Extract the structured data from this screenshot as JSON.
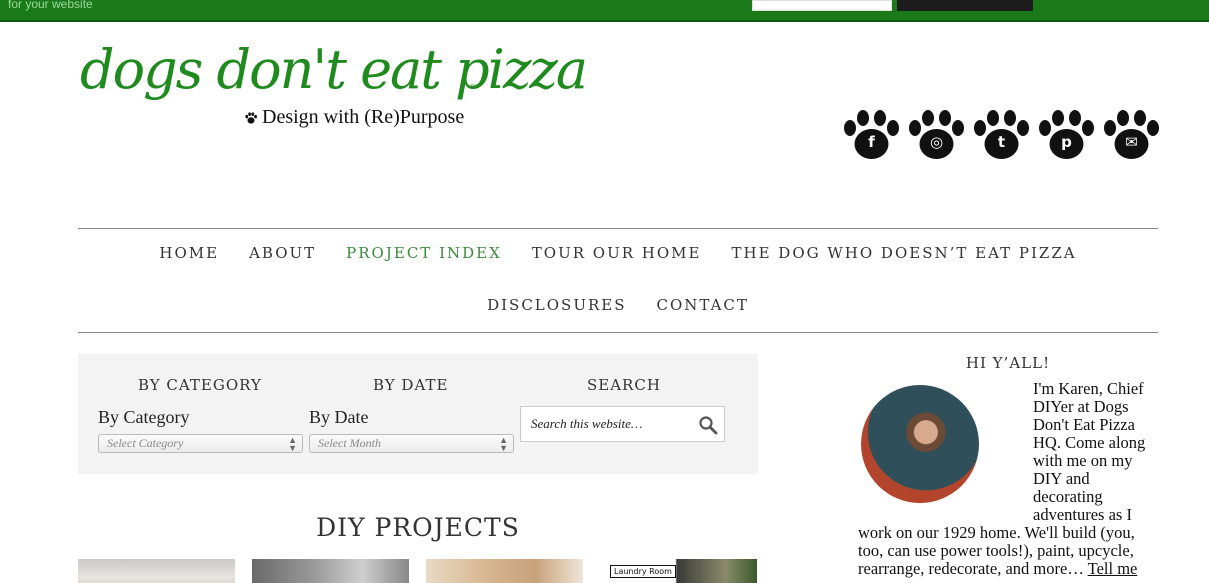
{
  "topbar": {
    "promo_text": "for your website",
    "bar_color": "#1a7a1a"
  },
  "logo": {
    "wordmark": "dogs don't eat pizza",
    "trademark": "™",
    "tagline": "Design with (Re)Purpose",
    "brand_color": "#1f8b1f"
  },
  "social": [
    {
      "name": "facebook",
      "glyph": "f"
    },
    {
      "name": "instagram",
      "glyph": "◎"
    },
    {
      "name": "twitter",
      "glyph": "t"
    },
    {
      "name": "pinterest",
      "glyph": "p"
    },
    {
      "name": "email",
      "glyph": "✉"
    }
  ],
  "nav": {
    "items": [
      {
        "label": "HOME"
      },
      {
        "label": "ABOUT"
      },
      {
        "label": "PROJECT INDEX",
        "active": true
      },
      {
        "label": "TOUR OUR HOME"
      },
      {
        "label": "THE DOG WHO DOESN’T EAT PIZZA"
      },
      {
        "label": "DISCLOSURES"
      },
      {
        "label": "CONTACT"
      }
    ]
  },
  "filters": {
    "category": {
      "heading": "BY CATEGORY",
      "label": "By Category",
      "selected": "Select Category"
    },
    "date": {
      "heading": "BY DATE",
      "label": "By Date",
      "selected": "Select Month"
    },
    "search": {
      "heading": "SEARCH",
      "placeholder": "Search this website…"
    }
  },
  "diy": {
    "title": "DIY PROJECTS",
    "thumbs": [
      {
        "caption": ""
      },
      {
        "caption": ""
      },
      {
        "caption": ""
      },
      {
        "caption": "Laundry Room"
      }
    ]
  },
  "sidebar": {
    "heading": "HI Y’ALL!",
    "bio": "I'm Karen, Chief DIYer at Dogs Don't Eat Pizza HQ. Come along with me on my DIY and decorating adventures as I work on our 1929 home. We'll build (you, too, can use power tools!), paint, upcycle, rearrange, redecorate, and more… ",
    "more_link": "Tell me more…"
  }
}
